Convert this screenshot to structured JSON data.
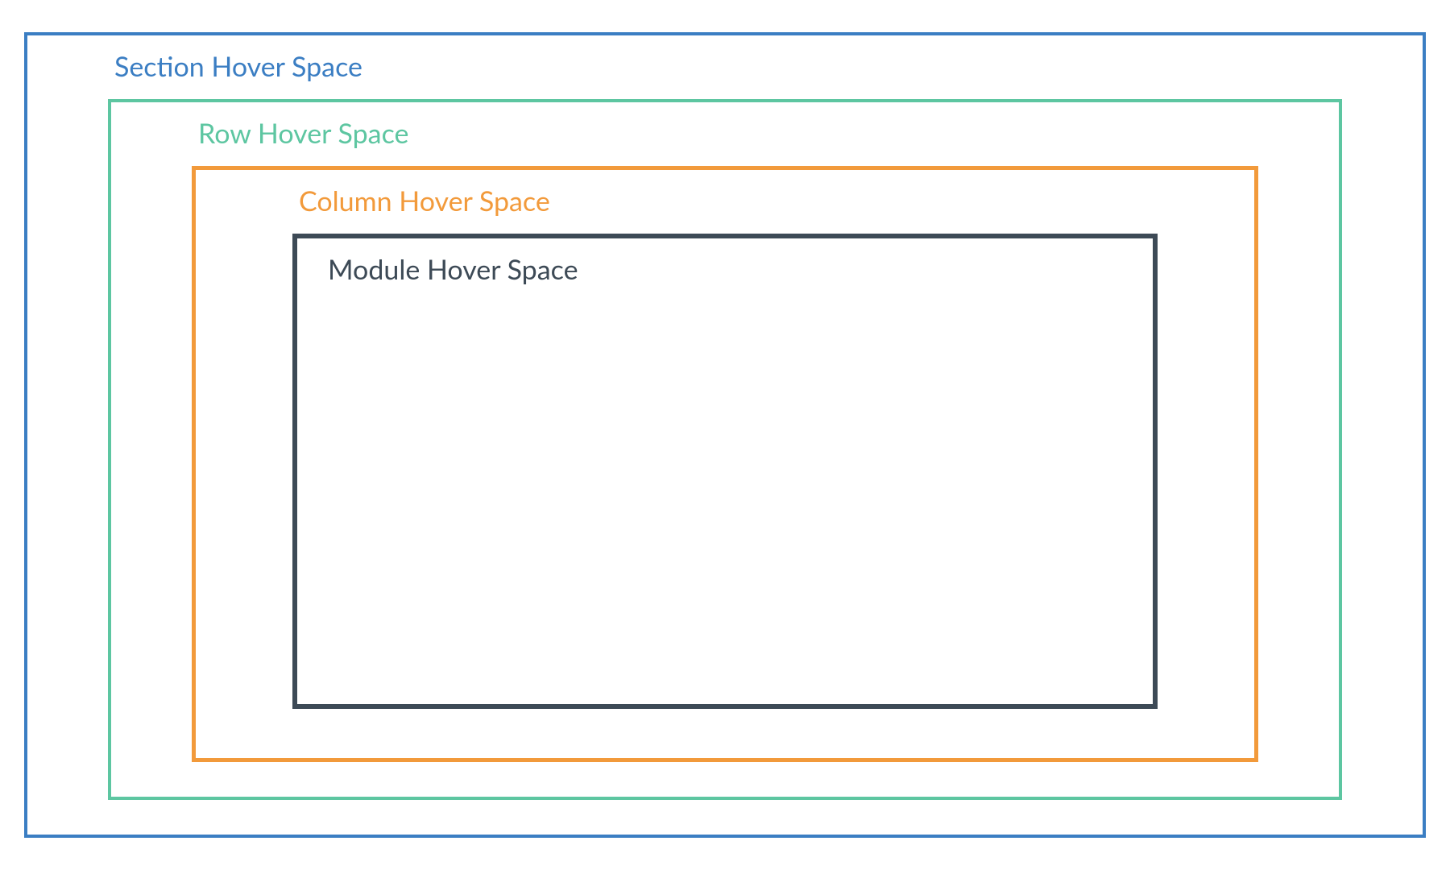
{
  "colors": {
    "section": "#3b7ec3",
    "row": "#5dc6a1",
    "column": "#f29a3b",
    "module": "#3d4a56"
  },
  "labels": {
    "section": "Section Hover Space",
    "row": "Row Hover Space",
    "column": "Column Hover Space",
    "module": "Module Hover Space"
  }
}
